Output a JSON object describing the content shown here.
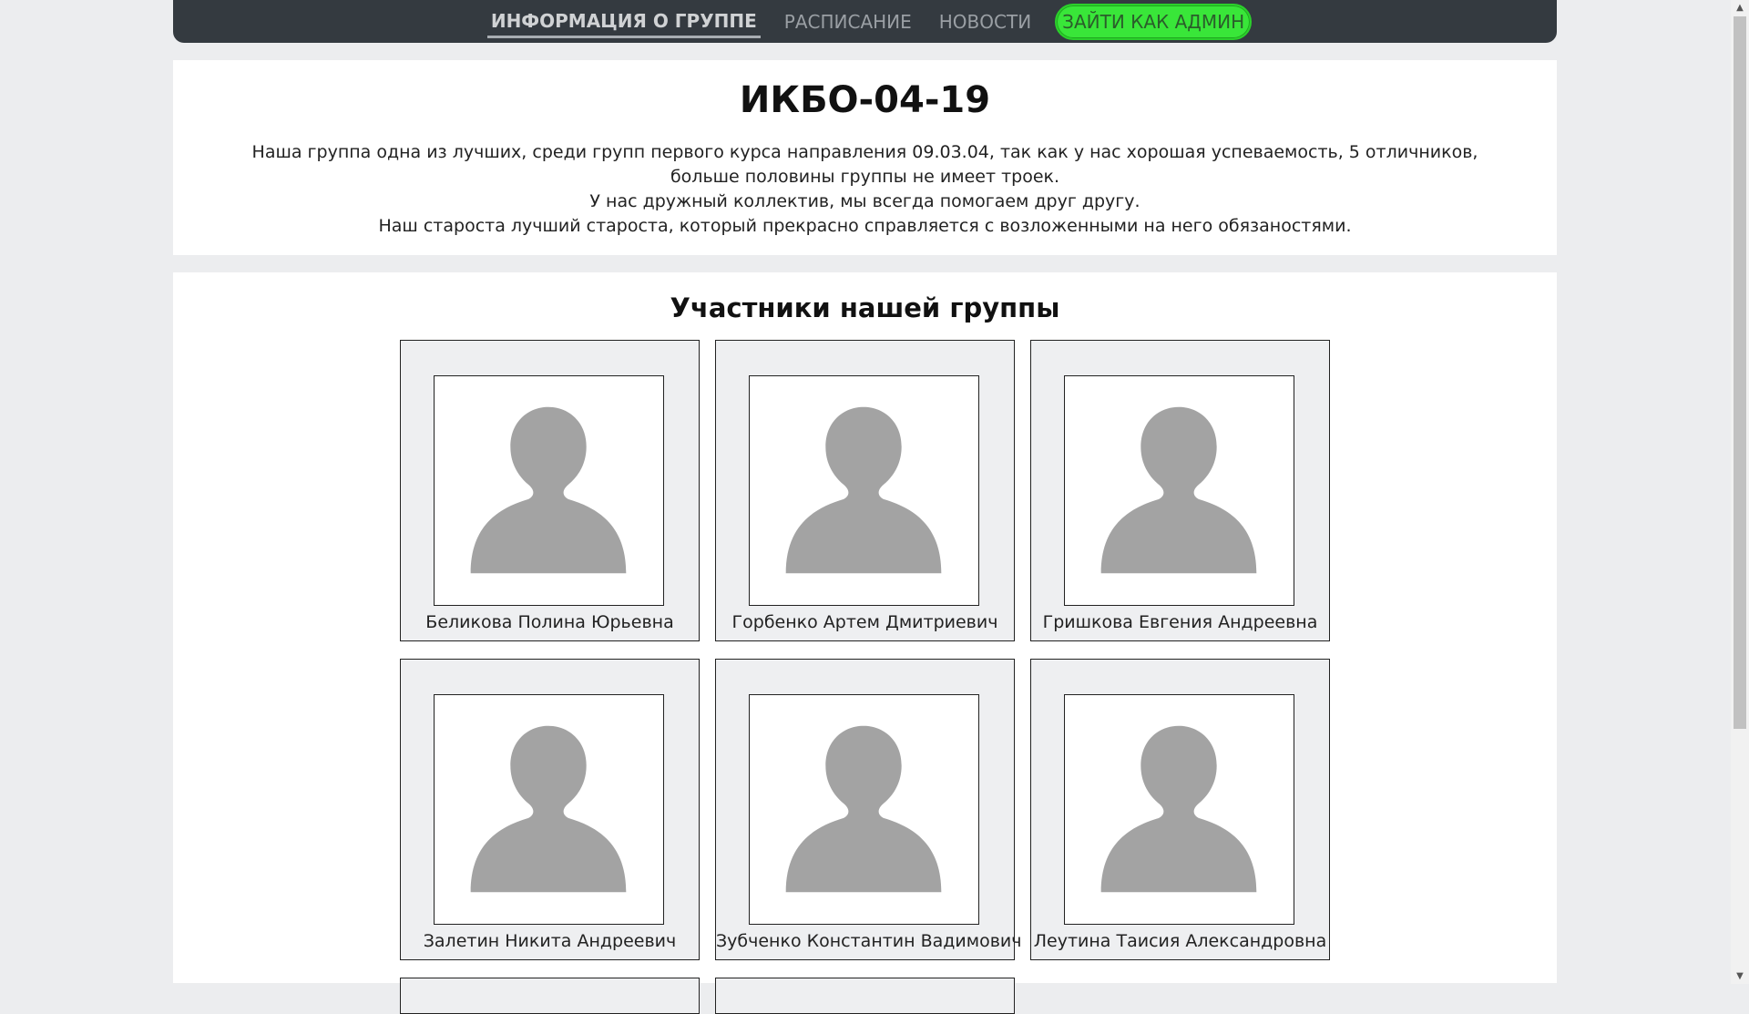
{
  "nav": {
    "items": [
      {
        "label": "Информация о группе",
        "active": true
      },
      {
        "label": "Расписание",
        "active": false
      },
      {
        "label": "Новости",
        "active": false
      }
    ],
    "admin_button": "Зайти как админ"
  },
  "info": {
    "title": "ИКБО-04-19",
    "lines": [
      "Наша группа одна из лучших, среди групп первого курса направления 09.03.04, так как у нас хорошая успеваемость, 5 отличников,",
      "больше половины группы не имеет троек.",
      "У нас дружный коллектив, мы всегда помогаем друг другу.",
      "Наш староста лучший староста, который прекрасно справляется с возложенными на него обязаностями."
    ]
  },
  "members": {
    "title": "Участники нашей группы",
    "list": [
      {
        "name": "Беликова Полина Юрьевна"
      },
      {
        "name": "Горбенко Артем Дмитриевич"
      },
      {
        "name": "Гришкова Евгения Андреевна"
      },
      {
        "name": "Залетин Никита Андреевич"
      },
      {
        "name": "Зубченко Константин Вадимович"
      },
      {
        "name": "Леутина Таисия Александровна"
      }
    ]
  },
  "colors": {
    "navbar": "#343a40",
    "admin_button": "#39e639",
    "avatar_placeholder": "#a3a3a3"
  },
  "icons": {
    "avatar": "user-silhouette-icon"
  }
}
